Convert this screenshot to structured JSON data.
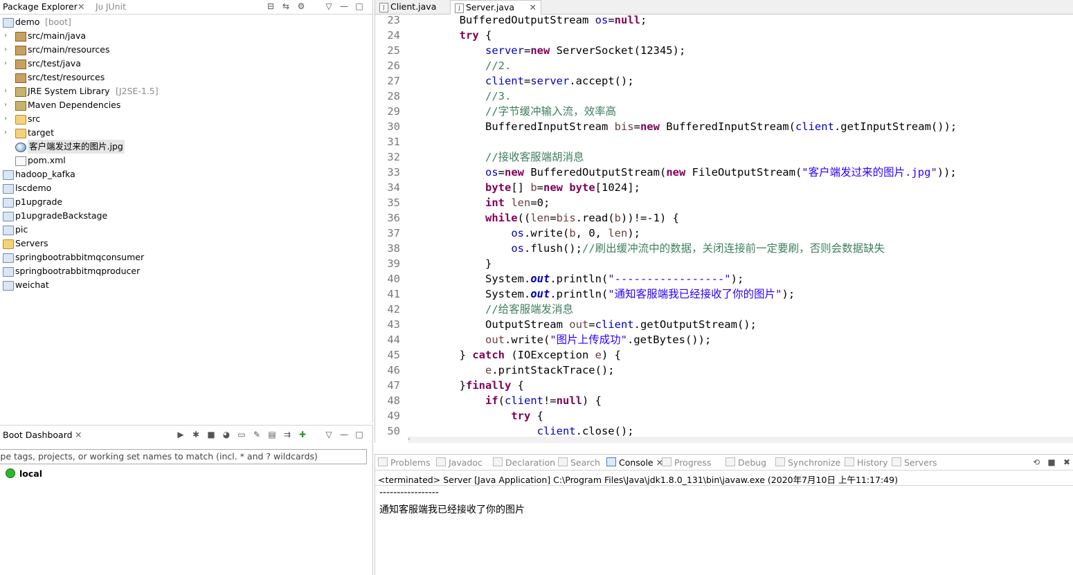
{
  "package_explorer": {
    "tab_title": "Package Explorer",
    "tab2_title": "JUnit",
    "tree": [
      {
        "label": "demo",
        "suffix": "[boot]",
        "indent": 0,
        "arrow": "",
        "icon": "project-icon"
      },
      {
        "label": "src/main/java",
        "suffix": "",
        "indent": 1,
        "arrow": ">",
        "icon": "package-folder-icon"
      },
      {
        "label": "src/main/resources",
        "suffix": "",
        "indent": 1,
        "arrow": ">",
        "icon": "package-folder-icon"
      },
      {
        "label": "src/test/java",
        "suffix": "",
        "indent": 1,
        "arrow": ">",
        "icon": "package-folder-icon"
      },
      {
        "label": "src/test/resources",
        "suffix": "",
        "indent": 1,
        "arrow": "",
        "icon": "package-folder-icon"
      },
      {
        "label": "JRE System Library",
        "suffix": "[J2SE-1.5]",
        "indent": 1,
        "arrow": ">",
        "icon": "library-icon"
      },
      {
        "label": "Maven Dependencies",
        "suffix": "",
        "indent": 1,
        "arrow": ">",
        "icon": "library-icon"
      },
      {
        "label": "src",
        "suffix": "",
        "indent": 1,
        "arrow": ">",
        "icon": "folder-icon"
      },
      {
        "label": "target",
        "suffix": "",
        "indent": 1,
        "arrow": ">",
        "icon": "folder-icon"
      },
      {
        "label": "客户端发过来的图片.jpg",
        "suffix": "",
        "indent": 1,
        "arrow": "",
        "icon": "image-file-icon",
        "selected": true
      },
      {
        "label": "pom.xml",
        "suffix": "",
        "indent": 1,
        "arrow": "",
        "icon": "xml-file-icon"
      },
      {
        "label": "hadoop_kafka",
        "suffix": "",
        "indent": 0,
        "arrow": "",
        "icon": "closed-project-icon"
      },
      {
        "label": "lscdemo",
        "suffix": "",
        "indent": 0,
        "arrow": "",
        "icon": "closed-project-icon"
      },
      {
        "label": "p1upgrade",
        "suffix": "",
        "indent": 0,
        "arrow": "",
        "icon": "closed-project-icon"
      },
      {
        "label": "p1upgradeBackstage",
        "suffix": "",
        "indent": 0,
        "arrow": "",
        "icon": "closed-project-icon"
      },
      {
        "label": "pic",
        "suffix": "",
        "indent": 0,
        "arrow": "",
        "icon": "closed-project-icon"
      },
      {
        "label": "Servers",
        "suffix": "",
        "indent": 0,
        "arrow": "",
        "icon": "folder-icon"
      },
      {
        "label": "springbootrabbitmqconsumer",
        "suffix": "",
        "indent": 0,
        "arrow": "",
        "icon": "closed-project-icon"
      },
      {
        "label": "springbootrabbitmqproducer",
        "suffix": "",
        "indent": 0,
        "arrow": "",
        "icon": "closed-project-icon"
      },
      {
        "label": "weichat",
        "suffix": "",
        "indent": 0,
        "arrow": "",
        "icon": "closed-project-icon"
      }
    ]
  },
  "boot_dashboard": {
    "tab_title": "Boot Dashboard",
    "filter_text": "ype tags, projects, or working set names to match (incl. * and ? wildcards)",
    "local_label": "local"
  },
  "editor": {
    "tabs": [
      {
        "label": "Client.java",
        "active": false
      },
      {
        "label": "Server.java",
        "active": true
      }
    ],
    "lines": [
      {
        "n": "23",
        "html": "        <span>BufferedOutputStream</span> <span class=\"fld\">os</span>=<span class=\"kw\">null</span>;"
      },
      {
        "n": "24",
        "html": "        <span class=\"kw\">try</span> {"
      },
      {
        "n": "25",
        "html": "            <span class=\"fld\">server</span>=<span class=\"kw\">new</span> ServerSocket(12345);"
      },
      {
        "n": "26",
        "html": "            <span class=\"cm\">//2.</span>"
      },
      {
        "n": "27",
        "html": "            <span class=\"fld\">client</span>=<span class=\"fld\">server</span>.accept();"
      },
      {
        "n": "28",
        "html": "            <span class=\"cm\">//3.</span>"
      },
      {
        "n": "29",
        "html": "            <span class=\"cm\">//字节缓冲输入流，效率高</span>"
      },
      {
        "n": "30",
        "html": "            BufferedInputStream <span class=\"var\">bis</span>=<span class=\"kw\">new</span> BufferedInputStream(<span class=\"fld\">client</span>.getInputStream());"
      },
      {
        "n": "31",
        "html": ""
      },
      {
        "n": "32",
        "html": "            <span class=\"cm\">//接收客服端胡消息</span>"
      },
      {
        "n": "33",
        "html": "            <span class=\"fld\">os</span>=<span class=\"kw\">new</span> BufferedOutputStream(<span class=\"kw\">new</span> FileOutputStream(<span class=\"str\">\"客户端发过来的图片.jpg\"</span>));"
      },
      {
        "n": "34",
        "html": "            <span class=\"kw\">byte</span>[] <span class=\"var\">b</span>=<span class=\"kw\">new</span> <span class=\"kw\">byte</span>[1024];"
      },
      {
        "n": "35",
        "html": "            <span class=\"kw\">int</span> <span class=\"var\">len</span>=0;"
      },
      {
        "n": "36",
        "html": "            <span class=\"kw\">while</span>((<span class=\"var\">len</span>=<span class=\"var\">bis</span>.read(<span class=\"var\">b</span>))!=-1) {"
      },
      {
        "n": "37",
        "html": "                <span class=\"fld\">os</span>.write(<span class=\"var\">b</span>, 0, <span class=\"var\">len</span>);"
      },
      {
        "n": "38",
        "html": "                <span class=\"fld\">os</span>.flush();<span class=\"cm\">//刷出缓冲流中的数据，关闭连接前一定要刷，否则会数据缺失</span>"
      },
      {
        "n": "39",
        "html": "            }"
      },
      {
        "n": "40",
        "html": "            System.<span class=\"st\">out</span>.println(<span class=\"str\">\"-----------------\"</span>);"
      },
      {
        "n": "41",
        "html": "            System.<span class=\"st\">out</span>.println(<span class=\"str\">\"通知客服端我已经接收了你的图片\"</span>);"
      },
      {
        "n": "42",
        "html": "            <span class=\"cm\">//给客服端发消息</span>"
      },
      {
        "n": "43",
        "html": "            OutputStream <span class=\"var\">out</span>=<span class=\"fld\">client</span>.getOutputStream();"
      },
      {
        "n": "44",
        "html": "            <span class=\"var\">out</span>.write(<span class=\"str\">\"图片上传成功\"</span>.getBytes());"
      },
      {
        "n": "45",
        "html": "        } <span class=\"kw\">catch</span> (IOException <span class=\"var\">e</span>) {"
      },
      {
        "n": "46",
        "html": "            <span class=\"var\">e</span>.printStackTrace();"
      },
      {
        "n": "47",
        "html": "        }<span class=\"kw\">finally</span> {"
      },
      {
        "n": "48",
        "html": "            <span class=\"kw\">if</span>(<span class=\"fld\">client</span>!=<span class=\"kw\">null</span>) {"
      },
      {
        "n": "49",
        "html": "                <span class=\"kw\">try</span> {"
      },
      {
        "n": "50",
        "html": "                    <span class=\"fld\">client</span>.close();"
      }
    ]
  },
  "console": {
    "tabs": [
      "Problems",
      "Javadoc",
      "Declaration",
      "Search",
      "Console",
      "Progress",
      "Debug",
      "Synchronize",
      "History",
      "Servers"
    ],
    "active_tab": "Console",
    "terminated_line": "<terminated> Server [Java Application] C:\\Program Files\\Java\\jdk1.8.0_131\\bin\\javaw.exe (2020年7月10日 上午11:17:49)",
    "output": [
      "-----------------",
      "通知客服端我已经接收了你的图片"
    ]
  }
}
